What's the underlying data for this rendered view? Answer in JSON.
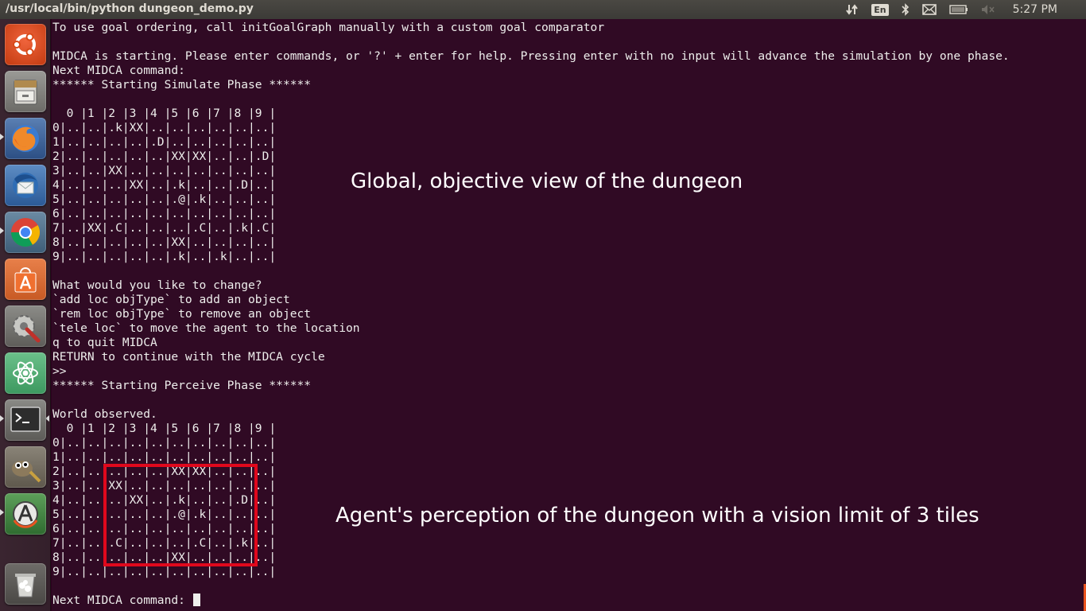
{
  "window": {
    "title": "/usr/local/bin/python dungeon_demo.py"
  },
  "indicators": {
    "language": "En",
    "clock": "5:27 PM"
  },
  "launcher": {
    "items": [
      {
        "name": "dash-home-button",
        "icon": "ubuntu-logo-icon"
      },
      {
        "name": "files-launcher",
        "icon": "file-cabinet-icon"
      },
      {
        "name": "firefox-launcher",
        "icon": "firefox-icon"
      },
      {
        "name": "thunderbird-launcher",
        "icon": "thunderbird-icon"
      },
      {
        "name": "chrome-launcher",
        "icon": "chrome-icon"
      },
      {
        "name": "software-center-launcher",
        "icon": "shopping-bag-icon"
      },
      {
        "name": "system-settings-launcher",
        "icon": "gear-wrench-icon"
      },
      {
        "name": "atom-launcher",
        "icon": "atom-icon"
      },
      {
        "name": "terminal-launcher",
        "icon": "terminal-icon"
      },
      {
        "name": "gimp-launcher",
        "icon": "gimp-icon"
      },
      {
        "name": "updater-launcher",
        "icon": "update-icon"
      },
      {
        "name": "trash-launcher",
        "icon": "trash-icon"
      }
    ]
  },
  "terminal": {
    "lines": [
      "To use goal ordering, call initGoalGraph manually with a custom goal comparator",
      "",
      "MIDCA is starting. Please enter commands, or '?' + enter for help. Pressing enter with no input will advance the simulation by one phase.",
      "Next MIDCA command:",
      "****** Starting Simulate Phase ******",
      "",
      "  0 |1 |2 |3 |4 |5 |6 |7 |8 |9 |",
      "0|..|..|.k|XX|..|..|..|..|..|..|",
      "1|..|..|..|..|.D|..|..|..|..|..|",
      "2|..|..|..|..|..|XX|XX|..|..|.D|",
      "3|..|..|XX|..|..|..|..|..|..|..|",
      "4|..|..|..|XX|..|.k|..|..|.D|..|",
      "5|..|..|..|..|..|.@|.k|..|..|..|",
      "6|..|..|..|..|..|..|..|..|..|..|",
      "7|..|XX|.C|..|..|..|.C|..|.k|.C|",
      "8|..|..|..|..|..|XX|..|..|..|..|",
      "9|..|..|..|..|..|.k|..|.k|..|..|",
      "",
      "What would you like to change?",
      "`add loc objType` to add an object",
      "`rem loc objType` to remove an object",
      "`tele loc` to move the agent to the location",
      "q to quit MIDCA",
      "RETURN to continue with the MIDCA cycle",
      ">>",
      "****** Starting Perceive Phase ******",
      "",
      "World observed.",
      "  0 |1 |2 |3 |4 |5 |6 |7 |8 |9 |",
      "0|..|..|..|..|..|..|..|..|..|..|",
      "1|..|..|..|..|..|..|..|..|..|..|",
      "2|..|..|..|..|..|XX|XX|..|..|..|",
      "3|..|..|XX|..|..|..|..|..|..|..|",
      "4|..|..|..|XX|..|.k|..|..|.D|..|",
      "5|..|..|..|..|..|.@|.k|..|..|..|",
      "6|..|..|..|..|..|..|..|..|..|..|",
      "7|..|..|.C|..|..|..|.C|..|.k|..|",
      "8|..|..|..|..|..|XX|..|..|..|..|",
      "9|..|..|..|..|..|..|..|..|..|..|",
      "",
      "Next MIDCA command: "
    ]
  },
  "annotations": {
    "global": "Global, objective view of the dungeon",
    "agent": "Agent's perception of the dungeon with a vision limit of 3 tiles"
  },
  "colors": {
    "terminal_bg": "#300a24",
    "terminal_fg": "#eeeeec",
    "highlight_box": "#e0081c",
    "panel_bg": "#3c3b37"
  }
}
